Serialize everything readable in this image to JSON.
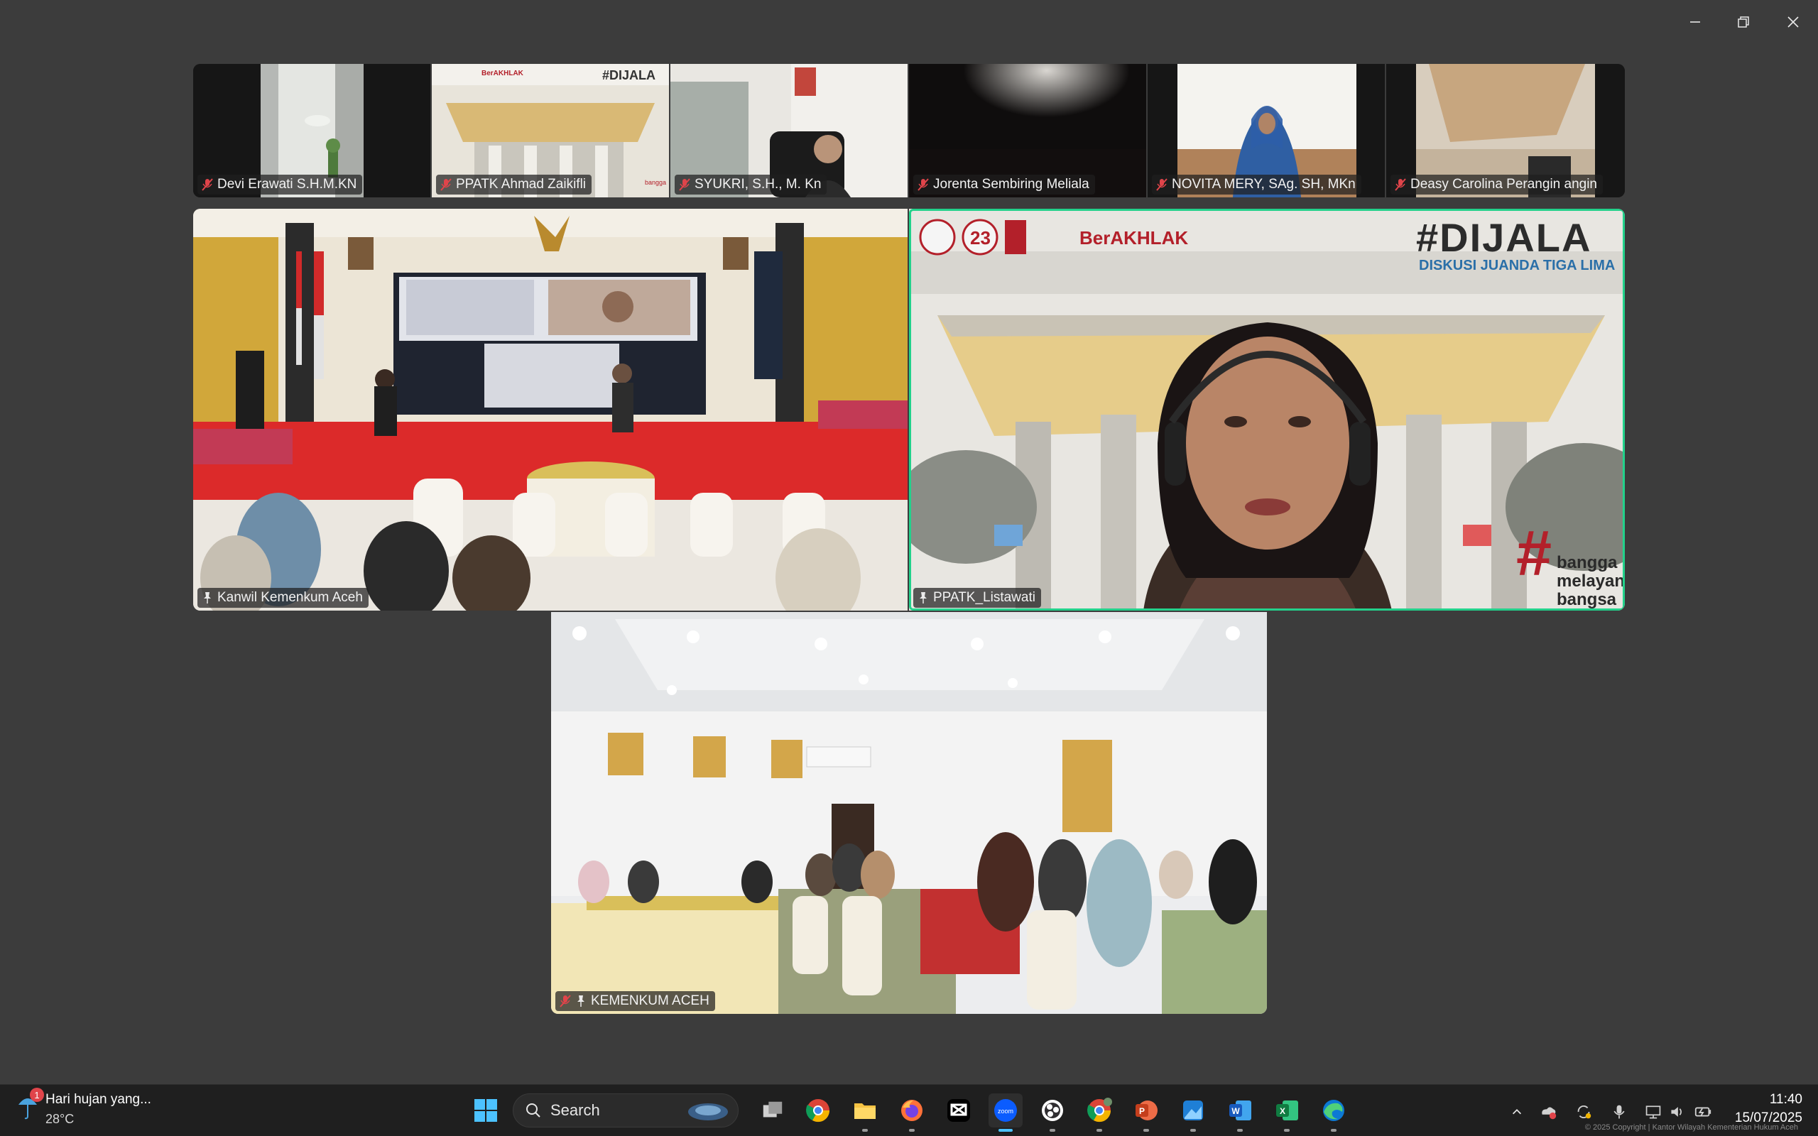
{
  "window": {
    "controls": {
      "minimize": "minimize-icon",
      "restore": "restore-icon",
      "close": "close-icon"
    }
  },
  "participants": {
    "devi": "Devi Erawati S.H.M.KN",
    "ahmad": "PPATK Ahmad Zaikifli",
    "syukri": "SYUKRI, S.H., M. Kn",
    "jorenta": "Jorenta Sembiring Meliala",
    "novita": "NOVITA MERY, SAg. SH, MKn",
    "deasy": "Deasy Carolina Perangin angin",
    "kanwil": "Kanwil Kemenkum Aceh",
    "listawati": "PPATK_Listawati",
    "kemenkum": "KEMENKUM ACEH"
  },
  "overlays": {
    "hashtag": "#DIJALA",
    "subtitle": "DISKUSI JUANDA TIGA LIMA",
    "berakhlak": "BerAKHLAK",
    "slogan1": "bangga",
    "slogan2": "melayani",
    "slogan3": "bangsa",
    "anniv": "23"
  },
  "taskbar": {
    "weather_text": "Hari hujan yang...",
    "temperature": "28°C",
    "weather_badge": "1",
    "search_label": "Search",
    "time": "11:40",
    "date": "15/07/2025",
    "copyright": "© 2025 Copyright | Kantor Wilayah Kementerian Hukum Aceh",
    "apps": [
      "start-icon",
      "search-icon",
      "task-view-icon",
      "chrome-icon",
      "file-explorer-icon",
      "firefox-icon",
      "capcut-icon",
      "zoom-icon",
      "obs-icon",
      "chrome-profile-icon",
      "powerpoint-icon",
      "photos-icon",
      "word-icon",
      "excel-icon",
      "edge-icon"
    ]
  },
  "colors": {
    "active_speaker": "#23d18b",
    "background": "#3c3c3c",
    "taskbar": "#1f1f1f"
  }
}
